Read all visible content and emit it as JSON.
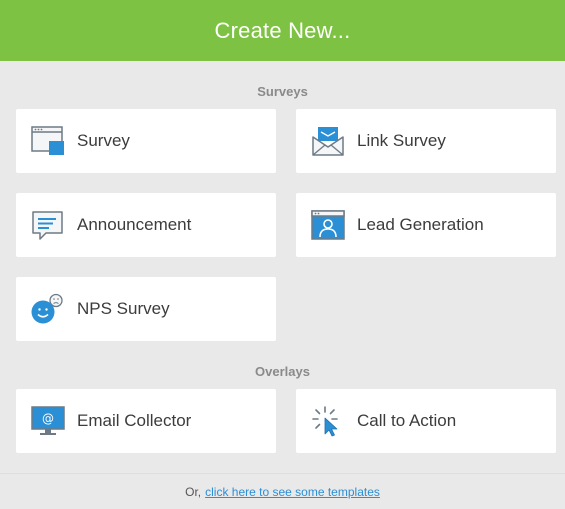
{
  "header": {
    "title": "Create New..."
  },
  "sections": {
    "surveys": {
      "heading": "Surveys"
    },
    "overlays": {
      "heading": "Overlays"
    }
  },
  "cards": {
    "survey": {
      "label": "Survey",
      "icon": "survey-window-icon"
    },
    "link_survey": {
      "label": "Link Survey",
      "icon": "envelope-icon"
    },
    "announcement": {
      "label": "Announcement",
      "icon": "speech-bubble-icon"
    },
    "lead_generation": {
      "label": "Lead Generation",
      "icon": "contact-card-icon"
    },
    "nps_survey": {
      "label": "NPS Survey",
      "icon": "smiley-faces-icon"
    },
    "email_collector": {
      "label": "Email Collector",
      "icon": "monitor-email-icon"
    },
    "call_to_action": {
      "label": "Call to Action",
      "icon": "cursor-click-icon"
    }
  },
  "footer": {
    "prefix": "Or,",
    "link_text": "click here to see some templates"
  },
  "colors": {
    "header_bg": "#7dc242",
    "accent_blue": "#2b8fd6",
    "background": "#e9e9e9"
  }
}
